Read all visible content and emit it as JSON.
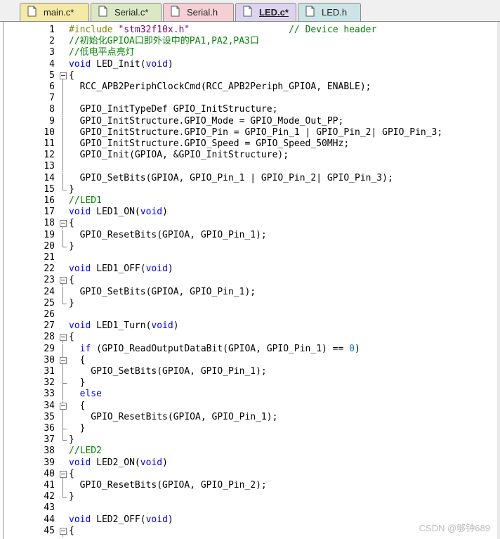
{
  "tabs": [
    {
      "label": "main.c*",
      "color": "#f5e9a6",
      "icon": "c-file-icon",
      "active": false
    },
    {
      "label": "Serial.c*",
      "color": "#dce8c4",
      "icon": "c-file-icon",
      "active": false
    },
    {
      "label": "Serial.h",
      "color": "#f4d0d6",
      "icon": "h-file-icon",
      "active": false
    },
    {
      "label": "LED.c*",
      "color": "#dcd4ee",
      "icon": "c-file-icon",
      "active": true
    },
    {
      "label": "LED.h",
      "color": "#cde4e6",
      "icon": "h-file-icon",
      "active": false
    }
  ],
  "lines": [
    {
      "n": "1",
      "f": "",
      "t": [
        [
          "pp",
          "#include "
        ],
        [
          "st",
          "\"stm32f10x.h\""
        ],
        [
          "",
          "                  "
        ],
        [
          "cm",
          "// Device header"
        ]
      ]
    },
    {
      "n": "2",
      "f": "",
      "t": [
        [
          "cm",
          "//初始化GPIOA口即外设中的PA1,PA2,PA3口"
        ]
      ]
    },
    {
      "n": "3",
      "f": "",
      "t": [
        [
          "cm",
          "//低电平点亮灯"
        ]
      ]
    },
    {
      "n": "4",
      "f": "",
      "t": [
        [
          "kw",
          "void"
        ],
        [
          "",
          " LED_Init("
        ],
        [
          "kw",
          "void"
        ],
        [
          "",
          ")"
        ]
      ]
    },
    {
      "n": "5",
      "f": "open",
      "t": [
        [
          "",
          "{"
        ]
      ]
    },
    {
      "n": "6",
      "f": "line",
      "t": [
        [
          "",
          "  RCC_APB2PeriphClockCmd(RCC_APB2Periph_GPIOA, ENABLE);"
        ]
      ]
    },
    {
      "n": "7",
      "f": "line",
      "t": [
        [
          "",
          ""
        ]
      ]
    },
    {
      "n": "8",
      "f": "line",
      "t": [
        [
          "",
          "  GPIO_InitTypeDef GPIO_InitStructure;"
        ]
      ]
    },
    {
      "n": "9",
      "f": "line",
      "t": [
        [
          "",
          "  GPIO_InitStructure.GPIO_Mode = GPIO_Mode_Out_PP;"
        ]
      ]
    },
    {
      "n": "10",
      "f": "line",
      "t": [
        [
          "",
          "  GPIO_InitStructure.GPIO_Pin = GPIO_Pin_1 | GPIO_Pin_2| GPIO_Pin_3;"
        ]
      ]
    },
    {
      "n": "11",
      "f": "line",
      "t": [
        [
          "",
          "  GPIO_InitStructure.GPIO_Speed = GPIO_Speed_50MHz;"
        ]
      ]
    },
    {
      "n": "12",
      "f": "line",
      "t": [
        [
          "",
          "  GPIO_Init(GPIOA, &GPIO_InitStructure);"
        ]
      ]
    },
    {
      "n": "13",
      "f": "line",
      "t": [
        [
          "",
          ""
        ]
      ]
    },
    {
      "n": "14",
      "f": "line",
      "t": [
        [
          "",
          "  GPIO_SetBits(GPIOA, GPIO_Pin_1 | GPIO_Pin_2| GPIO_Pin_3);"
        ]
      ]
    },
    {
      "n": "15",
      "f": "end",
      "t": [
        [
          "",
          "}"
        ]
      ]
    },
    {
      "n": "16",
      "f": "",
      "t": [
        [
          "cm",
          "//LED1"
        ]
      ]
    },
    {
      "n": "17",
      "f": "",
      "t": [
        [
          "kw",
          "void"
        ],
        [
          "",
          " LED1_ON("
        ],
        [
          "kw",
          "void"
        ],
        [
          "",
          ")"
        ]
      ]
    },
    {
      "n": "18",
      "f": "open",
      "t": [
        [
          "",
          "{"
        ]
      ]
    },
    {
      "n": "19",
      "f": "line",
      "t": [
        [
          "",
          "  GPIO_ResetBits(GPIOA, GPIO_Pin_1);"
        ]
      ]
    },
    {
      "n": "20",
      "f": "end",
      "t": [
        [
          "",
          "}"
        ]
      ]
    },
    {
      "n": "21",
      "f": "",
      "t": [
        [
          "",
          ""
        ]
      ]
    },
    {
      "n": "22",
      "f": "",
      "t": [
        [
          "kw",
          "void"
        ],
        [
          "",
          " LED1_OFF("
        ],
        [
          "kw",
          "void"
        ],
        [
          "",
          ")"
        ]
      ]
    },
    {
      "n": "23",
      "f": "open",
      "t": [
        [
          "",
          "{"
        ]
      ]
    },
    {
      "n": "24",
      "f": "line",
      "t": [
        [
          "",
          "  GPIO_SetBits(GPIOA, GPIO_Pin_1);"
        ]
      ]
    },
    {
      "n": "25",
      "f": "end",
      "t": [
        [
          "",
          "}"
        ]
      ]
    },
    {
      "n": "26",
      "f": "",
      "t": [
        [
          "",
          ""
        ]
      ]
    },
    {
      "n": "27",
      "f": "",
      "t": [
        [
          "kw",
          "void"
        ],
        [
          "",
          " LED1_Turn("
        ],
        [
          "kw",
          "void"
        ],
        [
          "",
          ")"
        ]
      ]
    },
    {
      "n": "28",
      "f": "open",
      "t": [
        [
          "",
          "{"
        ]
      ]
    },
    {
      "n": "29",
      "f": "line",
      "t": [
        [
          "",
          "  "
        ],
        [
          "kw",
          "if"
        ],
        [
          "",
          " (GPIO_ReadOutputDataBit(GPIOA, GPIO_Pin_1) == "
        ],
        [
          "num",
          "0"
        ],
        [
          "",
          ")"
        ]
      ]
    },
    {
      "n": "30",
      "f": "open",
      "t": [
        [
          "",
          "  {"
        ]
      ]
    },
    {
      "n": "31",
      "f": "line",
      "t": [
        [
          "",
          "    GPIO_SetBits(GPIOA, GPIO_Pin_1);"
        ]
      ]
    },
    {
      "n": "32",
      "f": "tick",
      "t": [
        [
          "",
          "  }"
        ]
      ]
    },
    {
      "n": "33",
      "f": "line",
      "t": [
        [
          "",
          "  "
        ],
        [
          "kw",
          "else"
        ]
      ]
    },
    {
      "n": "34",
      "f": "open",
      "t": [
        [
          "",
          "  {"
        ]
      ]
    },
    {
      "n": "35",
      "f": "line",
      "t": [
        [
          "",
          "    GPIO_ResetBits(GPIOA, GPIO_Pin_1);"
        ]
      ]
    },
    {
      "n": "36",
      "f": "tick",
      "t": [
        [
          "",
          "  }"
        ]
      ]
    },
    {
      "n": "37",
      "f": "end",
      "t": [
        [
          "",
          "}"
        ]
      ]
    },
    {
      "n": "38",
      "f": "",
      "t": [
        [
          "cm",
          "//LED2"
        ]
      ]
    },
    {
      "n": "39",
      "f": "",
      "t": [
        [
          "kw",
          "void"
        ],
        [
          "",
          " LED2_ON("
        ],
        [
          "kw",
          "void"
        ],
        [
          "",
          ")"
        ]
      ]
    },
    {
      "n": "40",
      "f": "open",
      "t": [
        [
          "",
          "{"
        ]
      ]
    },
    {
      "n": "41",
      "f": "line",
      "t": [
        [
          "",
          "  GPIO_ResetBits(GPIOA, GPIO_Pin_2);"
        ]
      ]
    },
    {
      "n": "42",
      "f": "end",
      "t": [
        [
          "",
          "}"
        ]
      ]
    },
    {
      "n": "43",
      "f": "",
      "t": [
        [
          "",
          ""
        ]
      ]
    },
    {
      "n": "44",
      "f": "",
      "t": [
        [
          "kw",
          "void"
        ],
        [
          "",
          " LED2_OFF("
        ],
        [
          "kw",
          "void"
        ],
        [
          "",
          ")"
        ]
      ]
    },
    {
      "n": "45",
      "f": "open",
      "t": [
        [
          "",
          "{"
        ]
      ]
    }
  ],
  "watermark": "CSDN @够钟689"
}
